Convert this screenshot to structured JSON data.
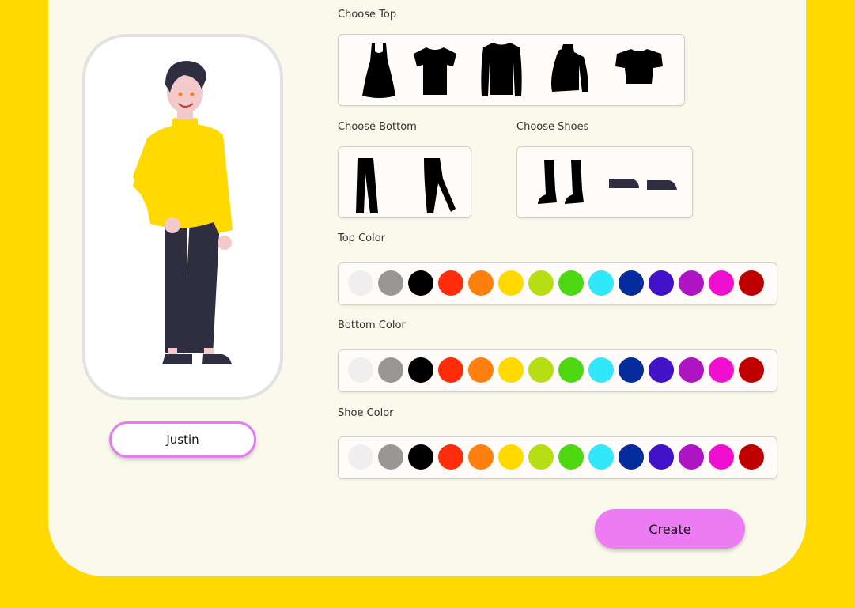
{
  "labels": {
    "choose_top": "Choose Top",
    "choose_bottom": "Choose Bottom",
    "choose_shoes": "Choose Shoes",
    "top_color": "Top Color",
    "bottom_color": "Bottom Color",
    "shoe_color": "Shoe Color"
  },
  "name_input": {
    "value": "Justin"
  },
  "create_button": {
    "label": "Create"
  },
  "tops": [
    "dress-icon",
    "tshirt-icon",
    "long-sleeve-shirt-icon",
    "turtleneck-icon",
    "crop-top-icon"
  ],
  "bottoms": [
    "straight-pants-icon",
    "tapered-pants-icon"
  ],
  "shoes": [
    "boots-icon",
    "flat-shoes-icon"
  ],
  "palette": [
    "#EFEFEF",
    "#9A9696",
    "#000000",
    "#FF2C0C",
    "#FF7F0F",
    "#FFD900",
    "#B7DD14",
    "#4ED811",
    "#32E7FA",
    "#062B9C",
    "#4212C8",
    "#AE14C3",
    "#F10FCF",
    "#BF0000"
  ],
  "avatar": {
    "top_color": "#FFD900",
    "bottom_color": "#2F2D40",
    "shoe_color": "#2F2D40"
  }
}
